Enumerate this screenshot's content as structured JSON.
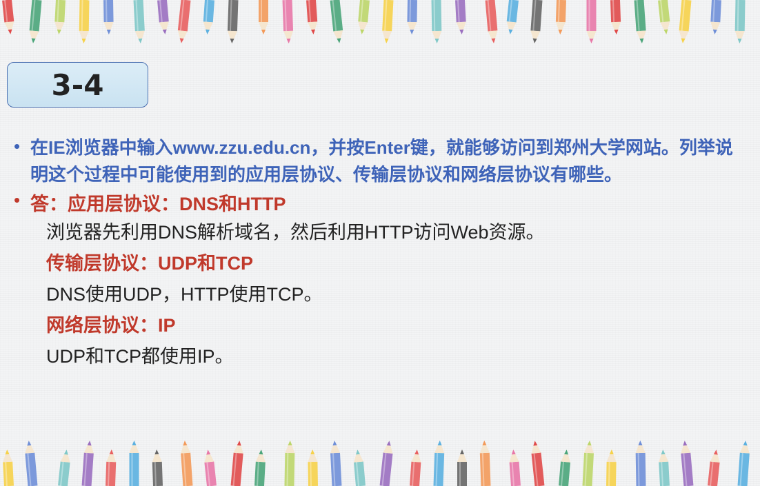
{
  "title": "3-4",
  "question": "在IE浏览器中输入www.zzu.edu.cn，并按Enter键，就能够访问到郑州大学网站。列举说明这个过程中可能使用到的应用层协议、传输层协议和网络层协议有哪些。",
  "answer_heading": "答：应用层协议：DNS和HTTP",
  "answer_lines": [
    "浏览器先利用DNS解析域名，然后利用HTTP访问Web资源。",
    "传输层协议：UDP和TCP",
    "DNS使用UDP，HTTP使用TCP。",
    "网络层协议：IP",
    "UDP和TCP都使用IP。"
  ],
  "colors": {
    "question": "#3e63b8",
    "heading": "#c0392b",
    "body": "#222222"
  },
  "decorations": [
    "pencil-border-top",
    "pencil-border-bottom"
  ]
}
